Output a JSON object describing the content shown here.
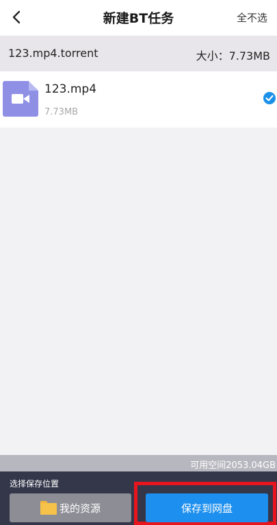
{
  "header": {
    "title": "新建BT任务",
    "deselect_all": "全不选"
  },
  "torrent": {
    "name": "123.mp4.torrent",
    "size": "大小：7.73MB"
  },
  "files": [
    {
      "name": "123.mp4",
      "size": "7.73MB",
      "selected": true,
      "icon": "video-file-icon"
    }
  ],
  "storage": {
    "available": "可用空间2053.04GB"
  },
  "bottom": {
    "choose_location": "选择保存位置",
    "my_resources": "我的资源",
    "save_to_cloud": "保存到网盘"
  },
  "colors": {
    "accent": "#1d8fef",
    "video_icon": "#8f8fe6",
    "bottom_panel": "#34374a",
    "highlight": "#e8151e"
  }
}
